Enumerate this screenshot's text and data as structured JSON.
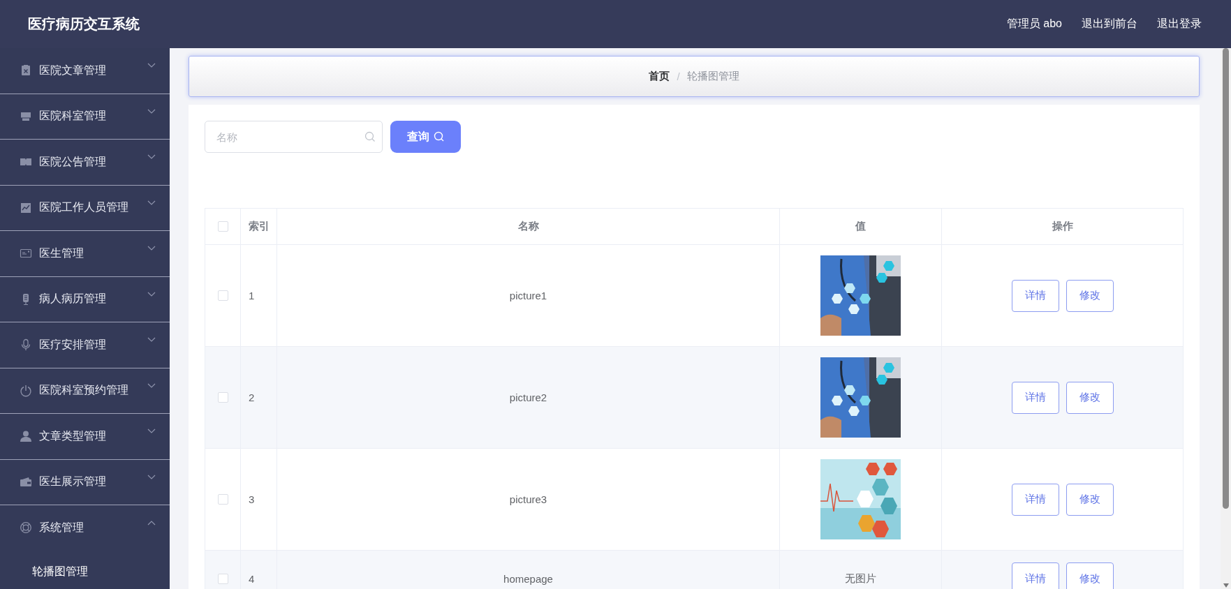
{
  "header": {
    "title": "医疗病历交互系统",
    "links": [
      "管理员 abo",
      "退出到前台",
      "退出登录"
    ]
  },
  "sidebar": {
    "items": [
      {
        "label": "医院文章管理",
        "expanded": false
      },
      {
        "label": "医院科室管理",
        "expanded": false
      },
      {
        "label": "医院公告管理",
        "expanded": false
      },
      {
        "label": "医院工作人员管理",
        "expanded": false
      },
      {
        "label": "医生管理",
        "expanded": false
      },
      {
        "label": "病人病历管理",
        "expanded": false
      },
      {
        "label": "医疗安排管理",
        "expanded": false
      },
      {
        "label": "医院科室预约管理",
        "expanded": false
      },
      {
        "label": "文章类型管理",
        "expanded": false
      },
      {
        "label": "医生展示管理",
        "expanded": false
      },
      {
        "label": "系统管理",
        "expanded": true,
        "children": [
          {
            "label": "轮播图管理"
          }
        ]
      }
    ]
  },
  "breadcrumb": {
    "items": [
      "首页",
      "轮播图管理"
    ],
    "separator": "/"
  },
  "search": {
    "placeholder": "名称",
    "button": "查询"
  },
  "table": {
    "columns": [
      "索引",
      "名称",
      "值",
      "操作"
    ],
    "header_checked": false,
    "rows": [
      {
        "checked": false,
        "index": "1",
        "name": "picture1",
        "value": {
          "kind": "picture"
        },
        "actions": [
          "详情",
          "修改"
        ]
      },
      {
        "checked": false,
        "index": "2",
        "name": "picture2",
        "value": {
          "kind": "picture"
        },
        "actions": [
          "详情",
          "修改"
        ]
      },
      {
        "checked": false,
        "index": "3",
        "name": "picture3",
        "value": {
          "kind": "picture"
        },
        "actions": [
          "详情",
          "修改"
        ]
      },
      {
        "checked": false,
        "index": "4",
        "name": "homepage",
        "value": {
          "kind": "text",
          "text": "无图片"
        },
        "actions": [
          "详情",
          "修改"
        ]
      }
    ]
  }
}
